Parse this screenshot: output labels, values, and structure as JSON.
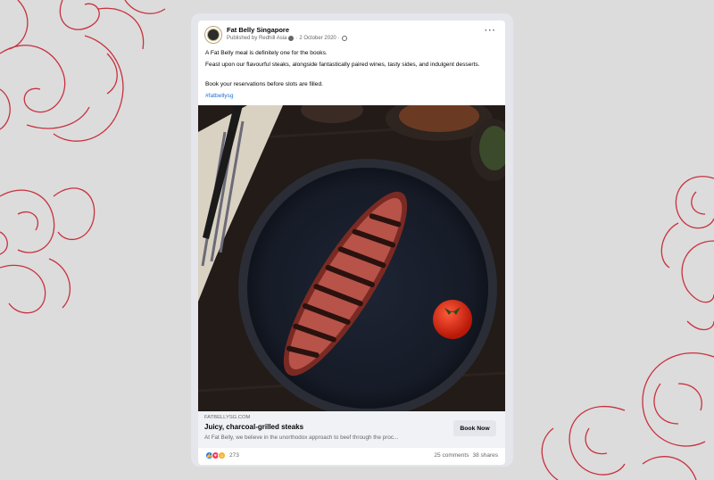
{
  "post": {
    "page_name": "Fat Belly Singapore",
    "published_by": "Published by Redhill Asia",
    "date": "2 October 2020",
    "more_icon": "more-horizontal-icon",
    "paragraphs": [
      "A Fat Belly meal is definitely one for the books.",
      "Feast upon our flavourful steaks, alongside fantastically paired wines, tasty sides, and indulgent desserts.",
      "Book your reservations before slots are filled."
    ],
    "hashtag": "#fatbellysg"
  },
  "link": {
    "domain": "FATBELLYSG.COM",
    "title": "Juicy, charcoal-grilled steaks",
    "description": "At Fat Belly, we believe in the unorthodox approach to beef through the proc...",
    "cta": "Book Now"
  },
  "engagement": {
    "reaction_icons": [
      "like-icon",
      "love-icon",
      "haha-icon"
    ],
    "reaction_count": "273",
    "comments": "25 comments",
    "shares": "38 shares"
  },
  "colors": {
    "background": "#dcdcdc",
    "ornament": "#c8313e",
    "link": "#216fdb",
    "like": "#1877f2",
    "love": "#f33e58",
    "haha": "#f7b125"
  }
}
